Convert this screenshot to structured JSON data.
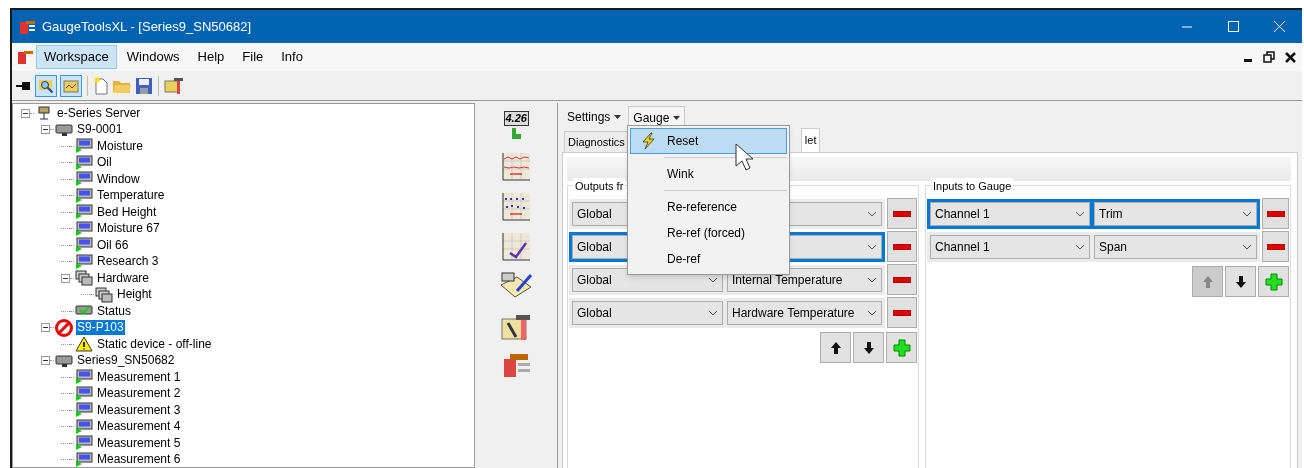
{
  "window": {
    "title": "GaugeToolsXL - [Series9_SN50682]"
  },
  "menu_bar": [
    {
      "label": "Workspace",
      "selected": true
    },
    {
      "label": "Windows",
      "selected": false
    },
    {
      "label": "Help",
      "selected": false
    },
    {
      "label": "File",
      "selected": false
    },
    {
      "label": "Info",
      "selected": false
    }
  ],
  "tree": [
    {
      "label": "e-Series Server",
      "kind": "server",
      "expanded": true,
      "selected": false,
      "children": [
        {
          "label": "S9-0001",
          "kind": "device",
          "expanded": true,
          "selected": false,
          "children": [
            {
              "label": "Moisture",
              "kind": "measurement",
              "selected": false
            },
            {
              "label": "Oil",
              "kind": "measurement",
              "selected": false
            },
            {
              "label": "Window",
              "kind": "measurement",
              "selected": false
            },
            {
              "label": "Temperature",
              "kind": "measurement",
              "selected": false
            },
            {
              "label": "Bed Height",
              "kind": "measurement",
              "selected": false
            },
            {
              "label": "Moisture 67",
              "kind": "measurement",
              "selected": false
            },
            {
              "label": "Oil 66",
              "kind": "measurement",
              "selected": false
            },
            {
              "label": "Research 3",
              "kind": "measurement",
              "selected": false
            },
            {
              "label": "Hardware",
              "kind": "hardware",
              "expanded": true,
              "selected": false,
              "children": [
                {
                  "label": "Height",
                  "kind": "hardware",
                  "selected": false
                }
              ]
            },
            {
              "label": "Status",
              "kind": "status",
              "selected": false
            }
          ]
        },
        {
          "label": "S9-P103",
          "kind": "offline-device",
          "expanded": true,
          "selected": true,
          "children": [
            {
              "label": "Static device - off-line",
              "kind": "warning",
              "selected": false
            }
          ]
        },
        {
          "label": "Series9_SN50682",
          "kind": "device",
          "expanded": true,
          "selected": false,
          "children": [
            {
              "label": "Measurement 1",
              "kind": "measurement",
              "selected": false
            },
            {
              "label": "Measurement 2",
              "kind": "measurement",
              "selected": false
            },
            {
              "label": "Measurement 3",
              "kind": "measurement",
              "selected": false
            },
            {
              "label": "Measurement 4",
              "kind": "measurement",
              "selected": false
            },
            {
              "label": "Measurement 5",
              "kind": "measurement",
              "selected": false
            },
            {
              "label": "Measurement 6",
              "kind": "measurement",
              "selected": false
            }
          ]
        }
      ]
    }
  ],
  "side_tools": {
    "badge": "4.26"
  },
  "panel_menus": [
    {
      "label": "Settings",
      "open": false
    },
    {
      "label": "Gauge",
      "open": true
    }
  ],
  "tabs": [
    {
      "label": "Diagnostics",
      "selected": false
    },
    {
      "label": "let",
      "selected": true
    }
  ],
  "outputs": {
    "title": "Outputs fr",
    "rows": [
      {
        "source": "Global",
        "selected": false
      },
      {
        "source": "Global",
        "selected": true
      },
      {
        "source": "Global",
        "signal": "Internal Temperature",
        "selected": false
      },
      {
        "source": "Global",
        "signal": "Hardware Temperature",
        "selected": false
      }
    ],
    "up_disabled": false
  },
  "inputs": {
    "title": "Inputs to Gauge",
    "rows": [
      {
        "source": "Channel 1",
        "signal": "Trim",
        "selected": true
      },
      {
        "source": "Channel 1",
        "signal": "Span",
        "selected": false
      }
    ],
    "up_disabled": true
  },
  "gauge_menu": [
    {
      "kind": "item",
      "label": "Reset",
      "selected": true
    },
    {
      "kind": "separator"
    },
    {
      "kind": "item",
      "label": "Wink",
      "selected": false
    },
    {
      "kind": "separator"
    },
    {
      "kind": "item",
      "label": "Re-reference",
      "selected": false
    },
    {
      "kind": "item",
      "label": "Re-ref (forced)",
      "selected": false
    },
    {
      "kind": "item",
      "label": "De-ref",
      "selected": false
    }
  ]
}
